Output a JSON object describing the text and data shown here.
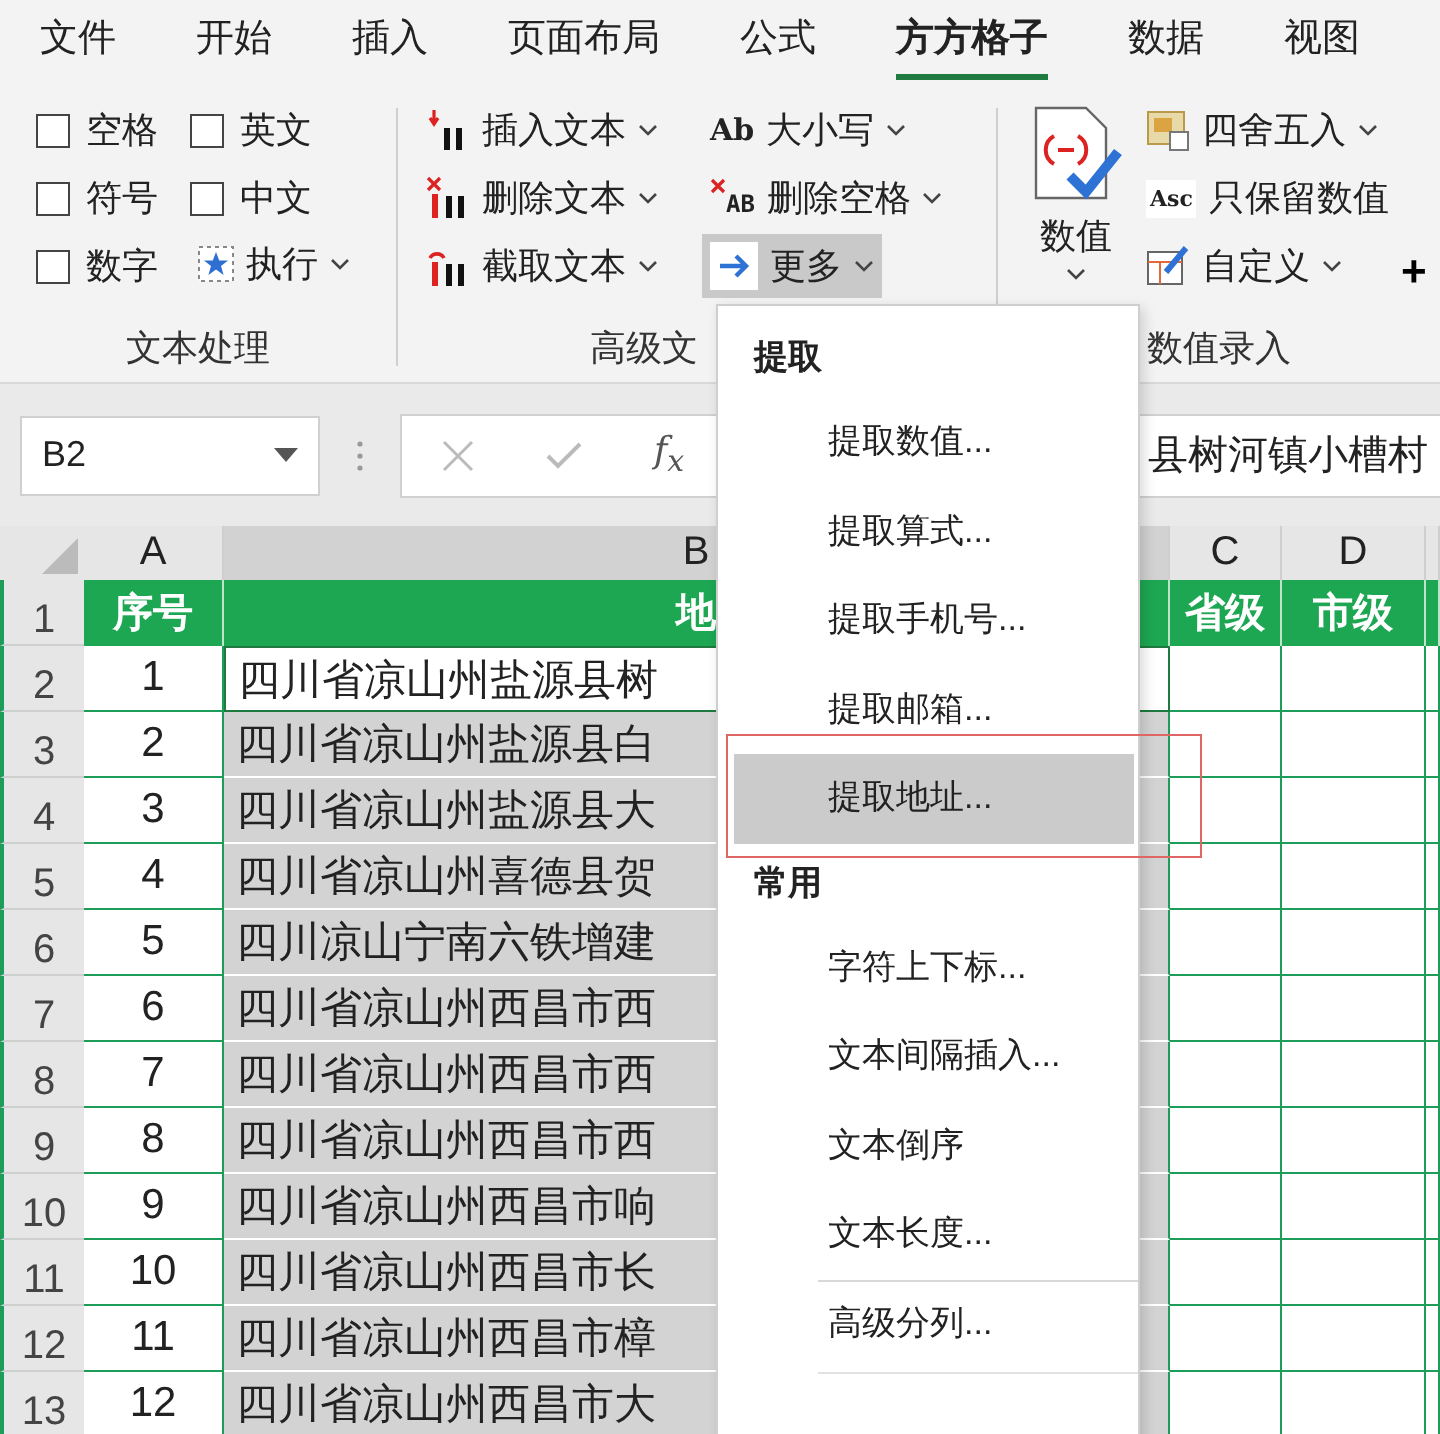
{
  "tabs": [
    {
      "label": "文件",
      "selected": false
    },
    {
      "label": "开始",
      "selected": false
    },
    {
      "label": "插入",
      "selected": false
    },
    {
      "label": "页面布局",
      "selected": false
    },
    {
      "label": "公式",
      "selected": false
    },
    {
      "label": "方方格子",
      "selected": true
    },
    {
      "label": "数据",
      "selected": false
    },
    {
      "label": "视图",
      "selected": false
    }
  ],
  "text_group": {
    "label": "文本处理",
    "checkboxes": [
      {
        "label": "空格",
        "checked": false
      },
      {
        "label": "英文",
        "checked": false
      },
      {
        "label": "符号",
        "checked": false
      },
      {
        "label": "中文",
        "checked": false
      },
      {
        "label": "数字",
        "checked": false
      }
    ],
    "run_button": "执行"
  },
  "advanced_group": {
    "label": "高级文",
    "buttons": [
      {
        "label": "插入文本",
        "pressed": false
      },
      {
        "label": "大小写",
        "icon_text": "Ab",
        "pressed": false
      },
      {
        "label": "删除文本",
        "pressed": false
      },
      {
        "label": "删除空格",
        "icon_text": "AB",
        "pressed": false
      },
      {
        "label": "截取文本",
        "pressed": false
      },
      {
        "label": "更多",
        "pressed": true
      }
    ]
  },
  "number_group": {
    "label": "数值录入",
    "big_button": "数值",
    "buttons": [
      {
        "label": "四舍五入",
        "dropdown": true
      },
      {
        "label": "只保留数值",
        "icon_text": "Asc",
        "dropdown": false
      },
      {
        "label": "自定义",
        "dropdown": true
      }
    ],
    "more": "+"
  },
  "formula_bar": {
    "name_box": "B2",
    "function_symbol": "f$_{x}$",
    "formula": "县树河镇小槽村"
  },
  "sheet": {
    "columns": [
      "A",
      "B",
      "C",
      "D"
    ],
    "header_row": {
      "number": "1",
      "cells": [
        "序号",
        "地",
        "省级",
        "市级"
      ]
    },
    "rows": [
      {
        "number": "2",
        "seq": "1",
        "address": "四川省凉山州盐源县树",
        "active": true
      },
      {
        "number": "3",
        "seq": "2",
        "address": "四川省凉山州盐源县白",
        "active": false
      },
      {
        "number": "4",
        "seq": "3",
        "address": "四川省凉山州盐源县大",
        "active": false
      },
      {
        "number": "5",
        "seq": "4",
        "address": "四川省凉山州喜德县贺",
        "active": false
      },
      {
        "number": "6",
        "seq": "5",
        "address": "四川凉山宁南六铁增建",
        "active": false
      },
      {
        "number": "7",
        "seq": "6",
        "address": "四川省凉山州西昌市西",
        "active": false
      },
      {
        "number": "8",
        "seq": "7",
        "address": "四川省凉山州西昌市西",
        "active": false
      },
      {
        "number": "9",
        "seq": "8",
        "address": "四川省凉山州西昌市西",
        "active": false
      },
      {
        "number": "10",
        "seq": "9",
        "address": "四川省凉山州西昌市响",
        "active": false
      },
      {
        "number": "11",
        "seq": "10",
        "address": "四川省凉山州西昌市长",
        "active": false
      },
      {
        "number": "12",
        "seq": "11",
        "address": "四川省凉山州西昌市樟",
        "active": false
      },
      {
        "number": "13",
        "seq": "12",
        "address": "四川省凉山州西昌市大",
        "active": false
      }
    ]
  },
  "menu": {
    "sections": [
      {
        "title": "提取",
        "items": [
          {
            "label": "提取数值...",
            "selected": false,
            "separator_before": false
          },
          {
            "label": "提取算式...",
            "selected": false,
            "separator_before": false
          },
          {
            "label": "提取手机号...",
            "selected": false,
            "separator_before": false
          },
          {
            "label": "提取邮箱...",
            "selected": false,
            "separator_before": false
          },
          {
            "label": "提取地址...",
            "selected": true,
            "separator_before": false
          }
        ]
      },
      {
        "title": "常用",
        "items": [
          {
            "label": "字符上下标...",
            "selected": false,
            "separator_before": false
          },
          {
            "label": "文本间隔插入...",
            "selected": false,
            "separator_before": false
          },
          {
            "label": "文本倒序",
            "selected": false,
            "separator_before": false
          },
          {
            "label": "文本长度...",
            "selected": false,
            "separator_before": false
          },
          {
            "label": "高级分列...",
            "selected": false,
            "separator_before": true
          }
        ]
      }
    ]
  }
}
